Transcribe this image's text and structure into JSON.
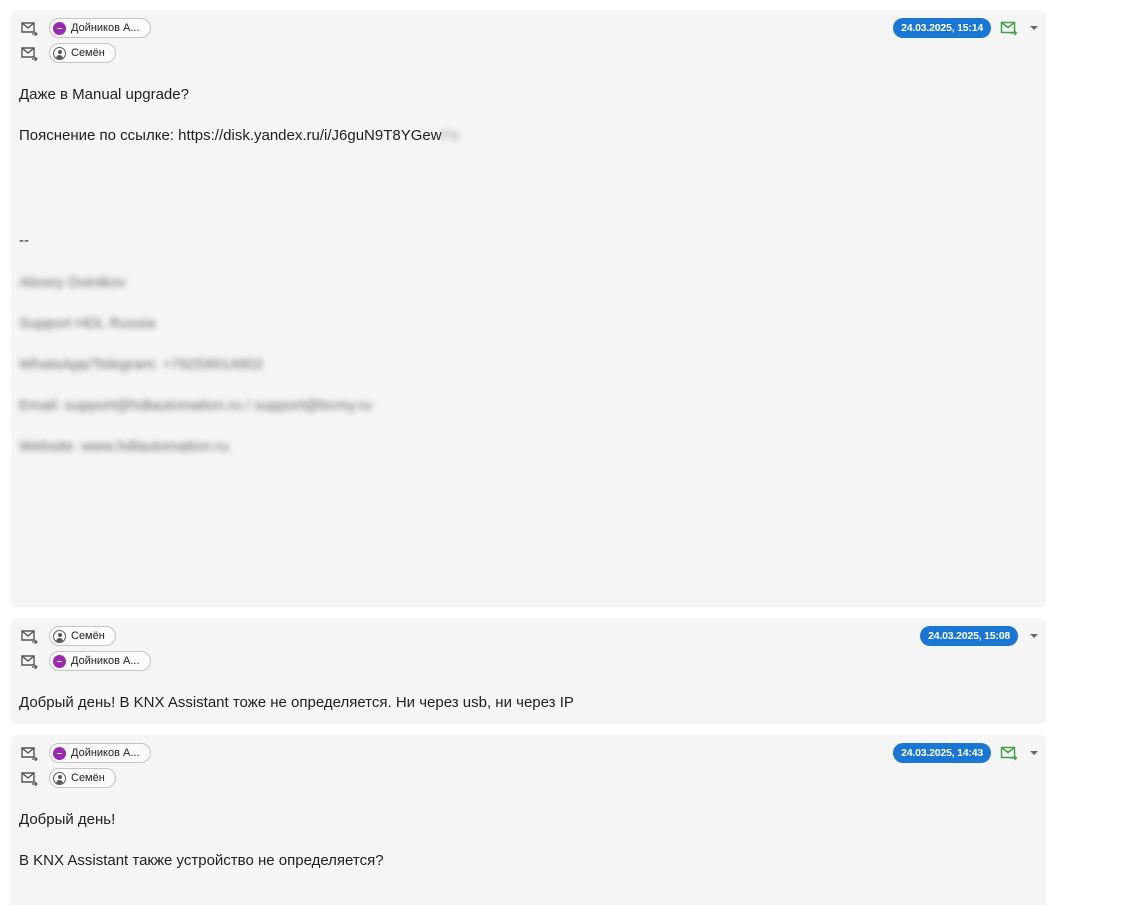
{
  "messages": [
    {
      "from": {
        "name": "Дойников А...",
        "avatar": "purple-minus"
      },
      "to": {
        "name": "Семён",
        "avatar": "user-circle"
      },
      "date": "24.03.2025, 15:14",
      "lines": [
        "Даже в Manual upgrade?",
        "--",
        "Alexey Doinikov",
        "Support HDL Russia",
        "WhatsApp/Telegram: +79259914902",
        "Email: support@hdlautomation.ru / support@bcmy.ru",
        "Website: www.hdlautomation.ru"
      ],
      "link_label": "Пояснение по ссылке: https://disk.yandex.ru/i/J6guN9T8YGew",
      "link_tail": "Fe"
    },
    {
      "from": {
        "name": "Семён",
        "avatar": "user-circle"
      },
      "to": {
        "name": "Дойников А...",
        "avatar": "purple-minus"
      },
      "date": "24.03.2025, 15:08",
      "lines": [
        "Добрый день! В KNX Assistant тоже не определяется. Ни через usb, ни через IP"
      ]
    },
    {
      "from": {
        "name": "Дойников А...",
        "avatar": "purple-minus"
      },
      "to": {
        "name": "Семён",
        "avatar": "user-circle"
      },
      "date": "24.03.2025, 14:43",
      "lines": [
        "Добрый день!",
        "В KNX Assistant также устройство не определяется?"
      ]
    }
  ],
  "icons": {
    "direction": "mail-direction-icon",
    "status": "mail-sent-icon",
    "menu": "caret-down-icon"
  },
  "colors": {
    "date_badge": "#1976d2",
    "status_icon": "#43a047",
    "avatar_purple": "#9c27b0",
    "card_bg": "#f5f5f5"
  }
}
